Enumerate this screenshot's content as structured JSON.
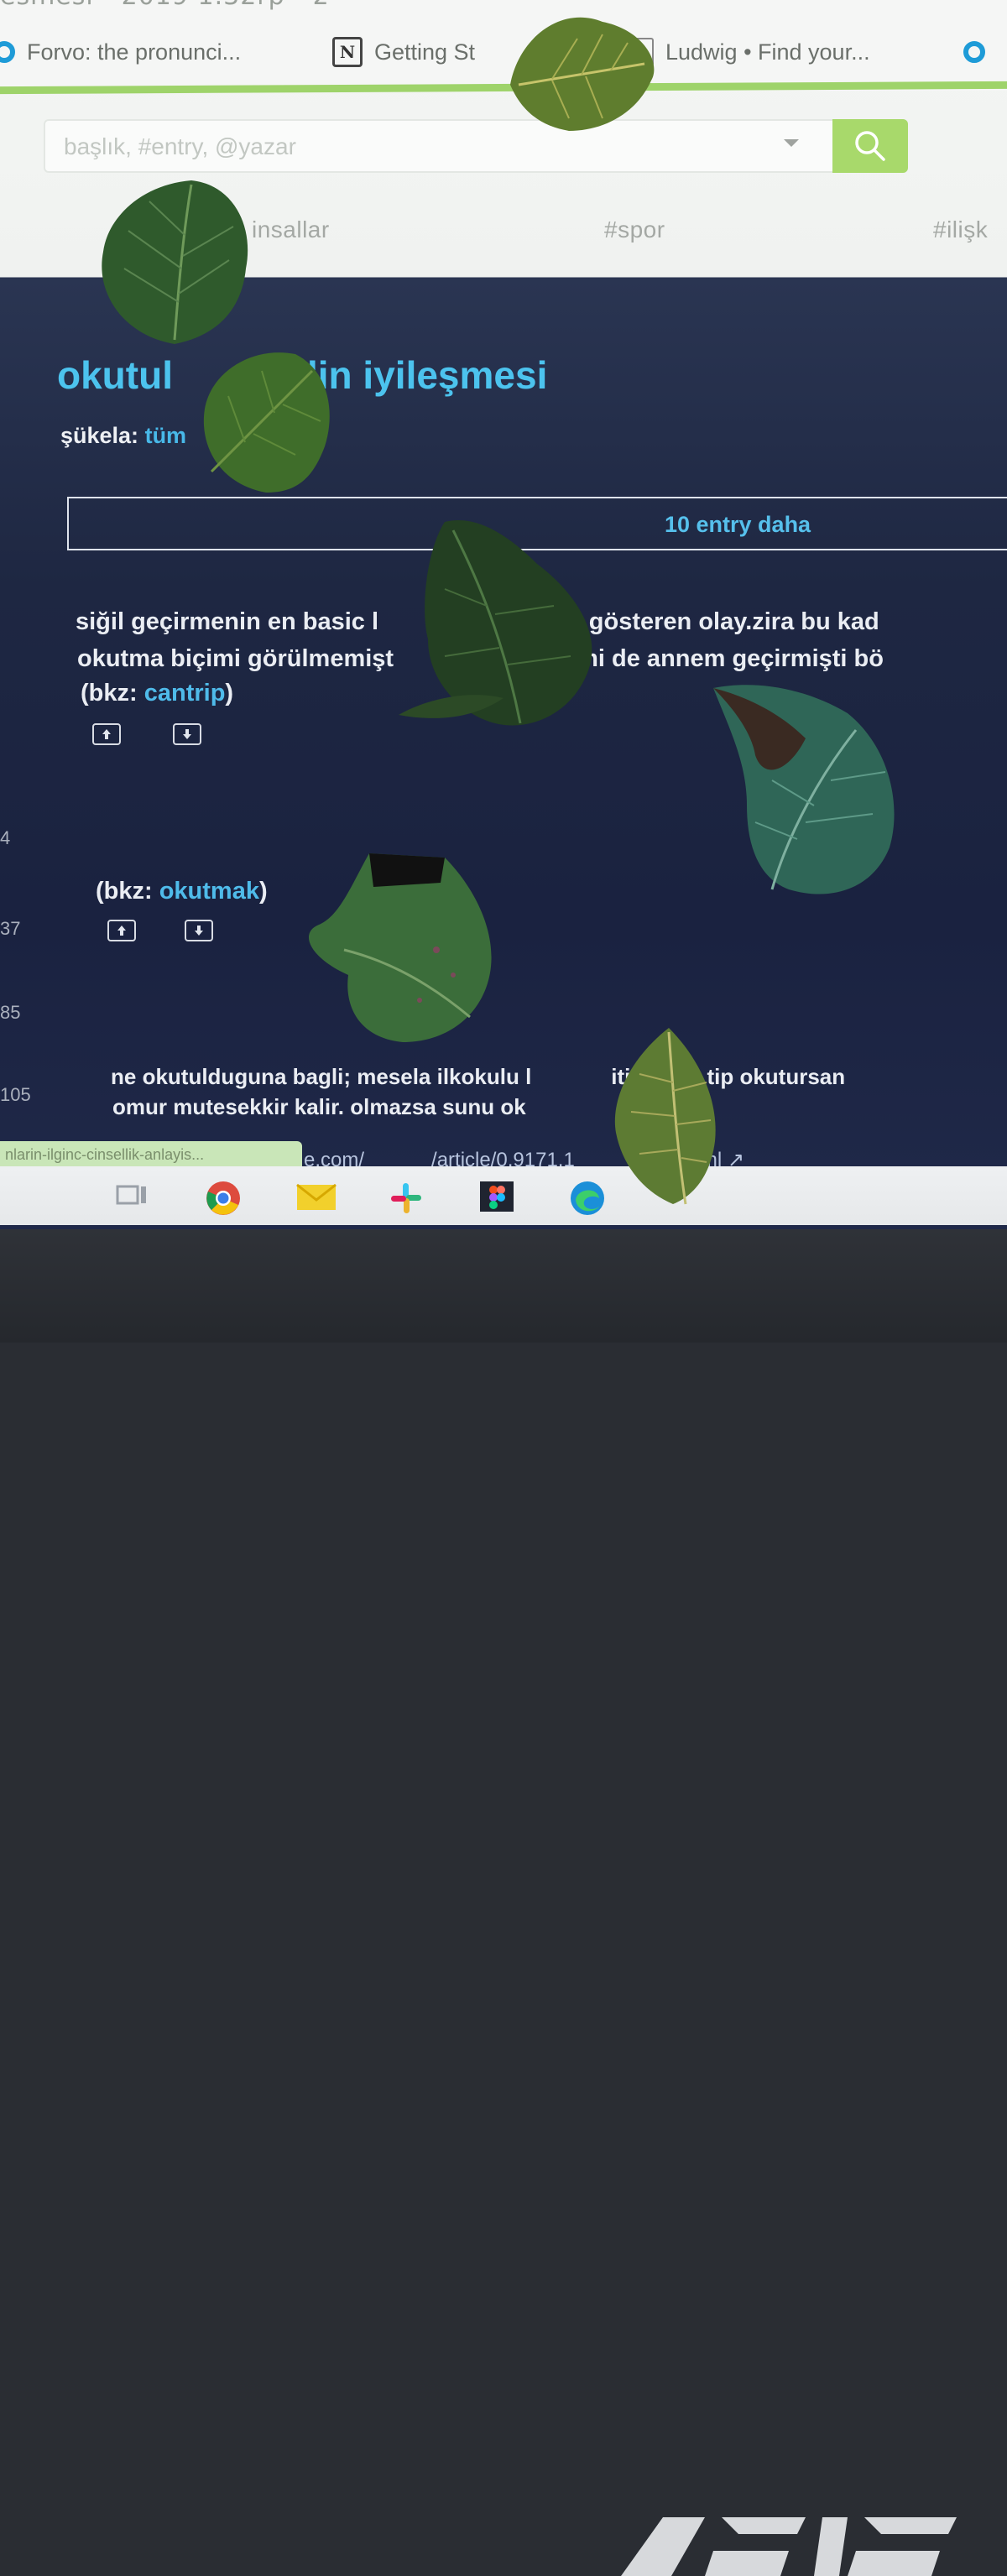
{
  "browser": {
    "tab_title_fragment": "esmesi - 2019 1.32rp - 2",
    "bookmarks": [
      {
        "label": "Forvo: the pronunci...",
        "icon": "forvo-icon"
      },
      {
        "label": "Getting St",
        "icon": "notion-icon"
      },
      {
        "label": "Ludwig • Find your...",
        "icon": "document-icon"
      }
    ]
  },
  "search": {
    "placeholder": "başlık, #entry, @yazar"
  },
  "channels": [
    "insallar",
    "#spor",
    "#ilişk"
  ],
  "topic": {
    "title_start": "okutul",
    "title_end": "lin iyileşmesi",
    "sukela_label": "şükela:",
    "sukela_value": "tüm",
    "more_entries": "10 entry daha"
  },
  "entries": [
    {
      "line1_a": "siğil geçirmenin en basic l",
      "line1_b": "u gösteren olay.zira bu kad",
      "line2_a": "okutma biçimi görülmemişt",
      "line2_b": "imi de annem geçirmişti bö",
      "bkz_prefix": "(bkz: ",
      "bkz_link": "cantrip",
      "bkz_suffix": ")"
    },
    {
      "bkz_prefix": "(bkz: ",
      "bkz_link": "okutmak",
      "bkz_suffix": ")"
    },
    {
      "line1_a": "ne okutulduguna bagli; mesela ilkokulu l",
      "line1_b": "itirmisse tip okutursan",
      "line2_a": "omur mutesekkir kalir. olmazsa sunu ok",
      "link_a": "e.com/",
      "link_b": "/article/0,9171,1",
      "link_c": "0.html"
    }
  ],
  "side_numbers": [
    "4",
    "37",
    "85",
    "105"
  ],
  "status_url": "nlarin-ilginc-cinsellik-anlayis...",
  "taskbar": [
    "task-view-icon",
    "chrome-icon",
    "mail-icon",
    "slack-icon",
    "figma-icon",
    "edge-icon"
  ],
  "colors": {
    "accent_green": "#a8d96b",
    "link_blue": "#4cc3ee",
    "dark_bg": "#1e2742"
  }
}
